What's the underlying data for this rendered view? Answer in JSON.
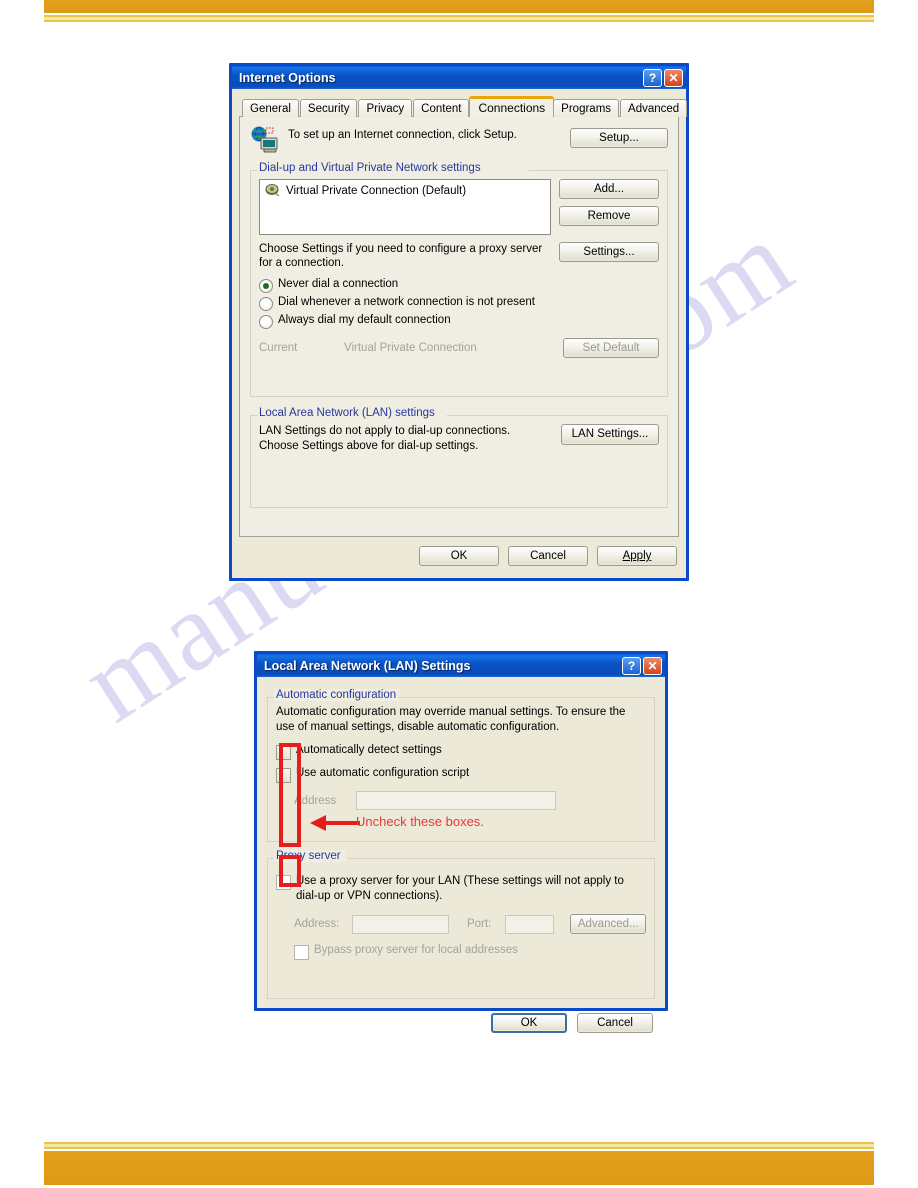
{
  "page": {
    "watermark": "manualshive.com",
    "bar_color": "#dd9a14"
  },
  "dialog_internet_options": {
    "title": "Internet Options",
    "titlebar_buttons": [
      {
        "name": "help",
        "glyph": "?"
      },
      {
        "name": "close",
        "glyph": "✕"
      }
    ],
    "tabs": [
      {
        "label": "General",
        "active": false
      },
      {
        "label": "Security",
        "active": false
      },
      {
        "label": "Privacy",
        "active": false
      },
      {
        "label": "Content",
        "active": false
      },
      {
        "label": "Connections",
        "active": true
      },
      {
        "label": "Programs",
        "active": false
      },
      {
        "label": "Advanced",
        "active": false
      }
    ],
    "setup": {
      "text": "To set up an Internet connection, click Setup.",
      "button": "Setup...",
      "icon": "globe-computer-icon"
    },
    "dialup_group": {
      "legend": "Dial-up and Virtual Private Network settings",
      "list_items": [
        {
          "label": "Virtual Private Connection (Default)",
          "icon": "network-connection-icon"
        }
      ],
      "buttons": [
        "Add...",
        "Remove",
        "Settings..."
      ],
      "hint": "Choose Settings if you need to configure a proxy server for a connection.",
      "radios": [
        {
          "label": "Never dial a connection",
          "selected": true,
          "highlighted": true
        },
        {
          "label": "Dial whenever a network connection is not present",
          "selected": false,
          "highlighted": false
        },
        {
          "label": "Always dial my default connection",
          "selected": false,
          "highlighted": false
        }
      ],
      "current_label": "Current",
      "current_value": "Virtual Private Connection",
      "set_default_button": "Set Default"
    },
    "lan_group": {
      "legend": "Local Area Network (LAN) settings",
      "text": "LAN Settings do not apply to dial-up connections. Choose Settings above for dial-up settings.",
      "button": "LAN Settings..."
    },
    "footer_buttons": [
      {
        "label": "OK",
        "default": true
      },
      {
        "label": "Cancel",
        "default": false
      },
      {
        "label": "Apply",
        "default": false
      }
    ]
  },
  "dialog_lan_settings": {
    "title": "Local Area Network (LAN) Settings",
    "titlebar_buttons": [
      {
        "name": "help",
        "glyph": "?"
      },
      {
        "name": "close",
        "glyph": "✕"
      }
    ],
    "auto_group": {
      "legend": "Automatic configuration",
      "description": "Automatic configuration may override manual settings.  To ensure the use of manual settings, disable automatic configuration.",
      "checkboxes": [
        {
          "label": "Automatically detect settings",
          "checked": false
        },
        {
          "label": "Use automatic configuration script",
          "checked": false
        }
      ],
      "address_label": "Address",
      "address_value": ""
    },
    "proxy_group": {
      "legend": "Proxy server",
      "use_proxy": {
        "label": "Use a proxy server for your LAN (These settings will not apply to dial-up or VPN connections).",
        "checked": false
      },
      "address_label": "Address:",
      "address_value": "",
      "port_label": "Port:",
      "port_value": "",
      "advanced_button": "Advanced...",
      "bypass": {
        "label": "Bypass proxy server for local addresses",
        "checked": false
      }
    },
    "footer_buttons": [
      {
        "label": "OK",
        "default": true
      },
      {
        "label": "Cancel",
        "default": false
      }
    ]
  },
  "annotations": {
    "note_text": "Uncheck these boxes.",
    "color": "#e51d1d"
  }
}
